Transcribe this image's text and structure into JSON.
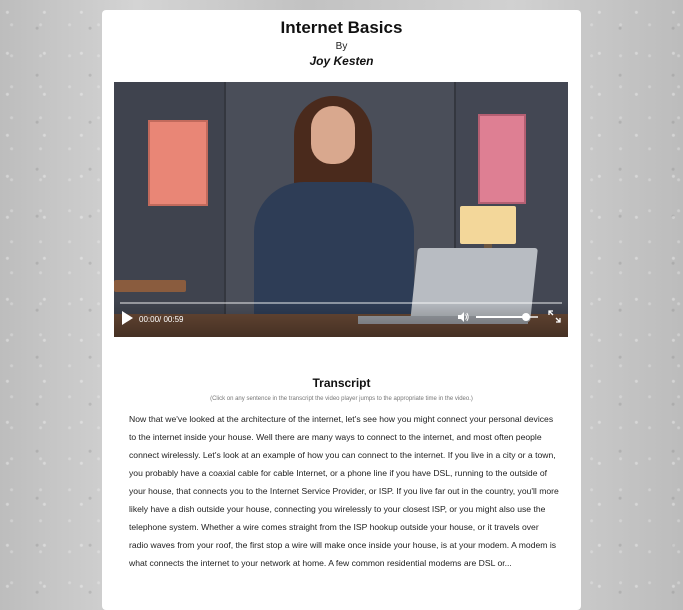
{
  "header": {
    "title": "Internet Basics",
    "by": "By",
    "author": "Joy Kesten"
  },
  "video": {
    "time": "00:00/ 00:59",
    "progress_fraction": 0,
    "volume_fraction": 0.8,
    "icons": [
      "play-icon",
      "volume-icon",
      "fullscreen-icon"
    ]
  },
  "transcript": {
    "heading": "Transcript",
    "note": "(Click on any sentence in the transcript the video player jumps to the appropriate time in the video.)",
    "sentences": [
      "Now that we've looked at the architecture of the internet, let's see how you might connect your personal devices to the internet inside your house.",
      "Well there are many ways to connect to the internet, and most often people connect wirelessly.",
      "Let's look at an example of how you can connect to the internet.",
      "If you live in a city or a town, you probably have a coaxial cable for cable Internet, or a phone line if you have DSL, running to the outside of your house, that connects you to the Internet Service Provider, or ISP.",
      "If you live far out in the country, you'll more likely have a dish outside your house, connecting you wirelessly to your closest ISP, or you might also use the telephone system.",
      "Whether a wire comes straight from the ISP hookup outside your house, or it travels over radio waves from your roof, the first stop a wire will make once inside your house, is at your modem.",
      "A modem is what connects the internet to your network at home.",
      "A few common residential modems are DSL or..."
    ]
  }
}
